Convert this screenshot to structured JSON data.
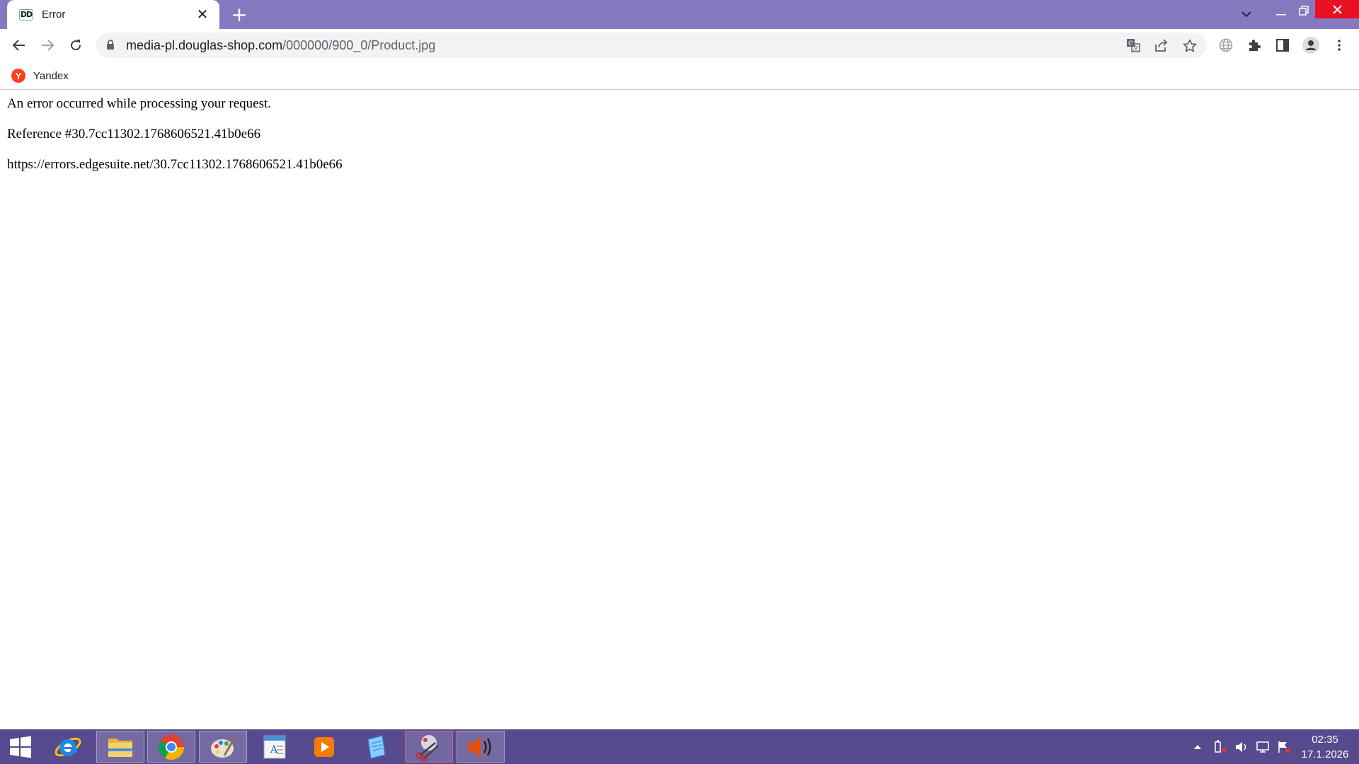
{
  "theme": {
    "frame_color": "#8779bf",
    "taskbar_color": "#584a8f",
    "close_button_color": "#e81123"
  },
  "tab": {
    "favicon_text": "DD",
    "title": "Error",
    "close_icon": "close-icon"
  },
  "toolbar": {
    "url_host": "media-pl.douglas-shop.com",
    "url_path": "/000000/900_0/Product.jpg",
    "icons": [
      "back-arrow-icon",
      "forward-arrow-icon",
      "reload-icon",
      "lock-icon",
      "translate-icon",
      "share-icon",
      "star-icon",
      "globe-icon",
      "extensions-icon",
      "side-panel-icon",
      "profile-icon",
      "more-menu-icon"
    ]
  },
  "bookmarks": {
    "items": [
      {
        "icon_letter": "Y",
        "label": "Yandex"
      }
    ]
  },
  "page": {
    "lines": [
      "An error occurred while processing your request.",
      "Reference #30.7cc11302.1768606521.41b0e66",
      "https://errors.edgesuite.net/30.7cc11302.1768606521.41b0e66"
    ]
  },
  "taskbar": {
    "apps": [
      "windows-start-icon",
      "internet-explorer-icon",
      "file-explorer-icon",
      "chrome-icon",
      "paint-icon",
      "address-book-icon",
      "media-player-icon",
      "notepad-icon",
      "snipping-tool-icon",
      "sound-icon"
    ],
    "tray_icons": [
      "show-hidden-icons-arrow",
      "power-icon",
      "volume-icon",
      "network-icon",
      "action-center-flag-icon"
    ],
    "time": "02:35",
    "date": "17.1.2026"
  }
}
